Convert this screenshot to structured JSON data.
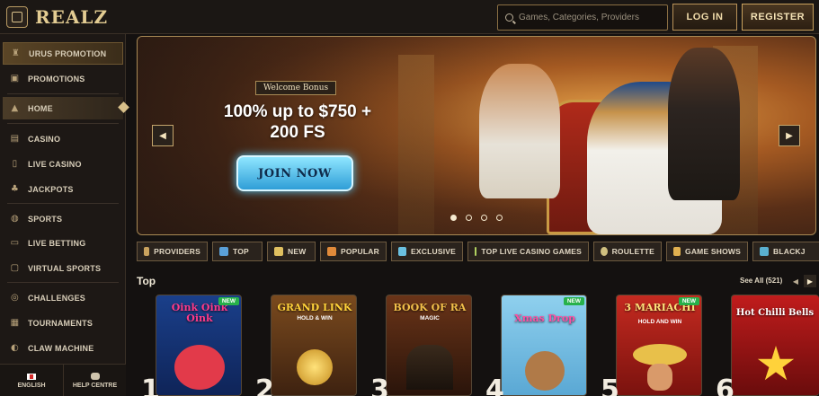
{
  "header": {
    "logo": "REALZ",
    "search_placeholder": "Games, Categories, Providers",
    "login_label": "LOG IN",
    "register_label": "REGISTER"
  },
  "sidebar": {
    "items": [
      {
        "label": "URUS PROMOTION",
        "icon": "trophy-icon"
      },
      {
        "label": "PROMOTIONS",
        "icon": "gift-icon"
      },
      {
        "label": "HOME",
        "icon": "pyramid-icon"
      },
      {
        "label": "CASINO",
        "icon": "slot-machine-icon"
      },
      {
        "label": "LIVE CASINO",
        "icon": "cards-icon"
      },
      {
        "label": "JACKPOTS",
        "icon": "clover-icon"
      },
      {
        "label": "SPORTS",
        "icon": "ball-icon"
      },
      {
        "label": "LIVE BETTING",
        "icon": "live-icon"
      },
      {
        "label": "VIRTUAL SPORTS",
        "icon": "monitor-icon"
      },
      {
        "label": "CHALLENGES",
        "icon": "target-icon"
      },
      {
        "label": "TOURNAMENTS",
        "icon": "tournament-icon"
      },
      {
        "label": "CLAW MACHINE",
        "icon": "claw-icon"
      }
    ],
    "footer": {
      "language": "ENGLISH",
      "help": "HELP CENTRE"
    }
  },
  "banner": {
    "tag": "Welcome Bonus",
    "line1": "100% up to $750 +",
    "line2": "200 FS",
    "cta": "JOIN NOW",
    "slides_total": 4,
    "active_slide": 1
  },
  "categories": [
    {
      "label": "PROVIDERS",
      "color": "#c9a25e"
    },
    {
      "label": "TOP",
      "color": "#5aa0d8"
    },
    {
      "label": "NEW",
      "color": "#e0c060"
    },
    {
      "label": "POPULAR",
      "color": "#e08a3a"
    },
    {
      "label": "EXCLUSIVE",
      "color": "#6ac0e0"
    },
    {
      "label": "TOP LIVE CASINO GAMES",
      "color": "#b0d060"
    },
    {
      "label": "ROULETTE",
      "color": "#d0c080"
    },
    {
      "label": "GAME SHOWS",
      "color": "#e0b050"
    },
    {
      "label": "BLACKJ",
      "color": "#5ab0d0"
    }
  ],
  "top": {
    "title": "Top",
    "see_all": "See All (521)",
    "games": [
      {
        "title": "Oink Oink Oink",
        "subtitle": "",
        "badge": "NEW",
        "rank": "1",
        "bg": "#1a3f8a",
        "title_color": "#ff3b8a"
      },
      {
        "title": "GRAND LINK",
        "subtitle": "HOLD & WIN",
        "badge": "",
        "rank": "2",
        "bg": "#6a3a18",
        "title_color": "#ffd23a"
      },
      {
        "title": "BOOK OF RA",
        "subtitle": "MAGIC",
        "badge": "",
        "rank": "3",
        "bg": "#5a2b14",
        "title_color": "#f3c04a"
      },
      {
        "title": "Xmas Drop",
        "subtitle": "",
        "badge": "NEW",
        "rank": "4",
        "bg": "#7fc6e8",
        "title_color": "#ff4fa3"
      },
      {
        "title": "3 MARIACHI",
        "subtitle": "HOLD AND WIN",
        "badge": "NEW",
        "rank": "5",
        "bg": "#b9231c",
        "title_color": "#ffe17a"
      },
      {
        "title": "Hot Chilli Bells",
        "subtitle": "",
        "badge": "",
        "rank": "6",
        "bg": "#b81818",
        "title_color": "#ffffff"
      }
    ]
  }
}
